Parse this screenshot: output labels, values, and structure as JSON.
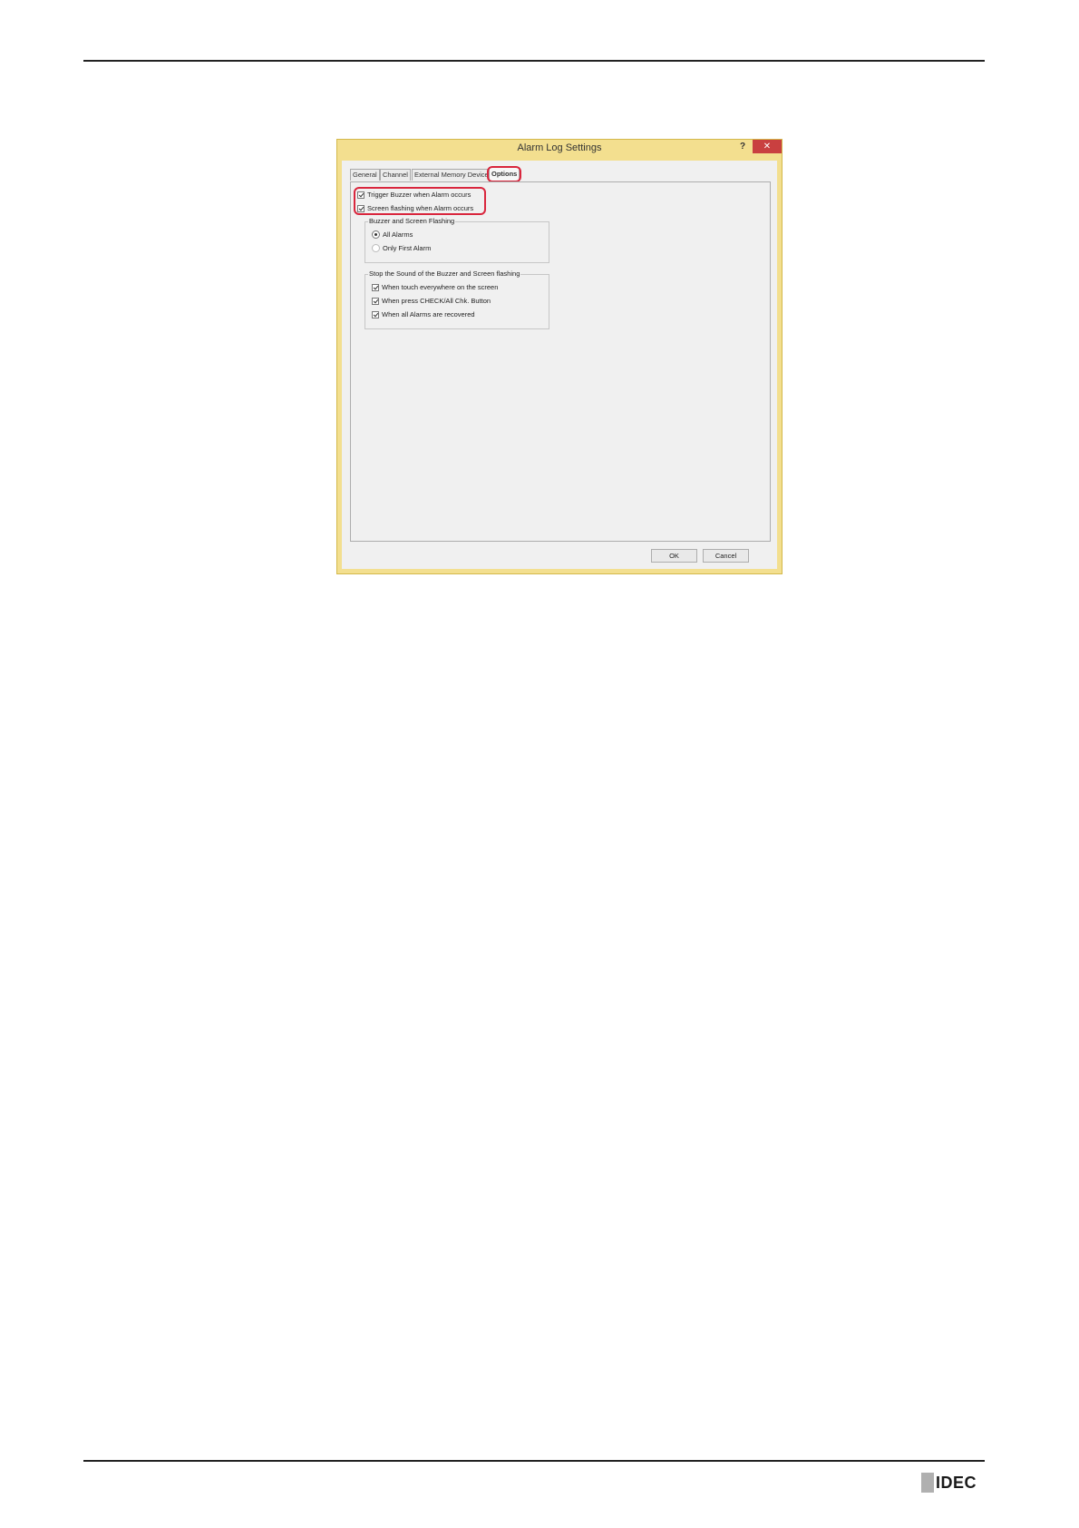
{
  "dialog": {
    "title": "Alarm Log Settings",
    "help_label": "?",
    "close_label": "✕",
    "tabs": [
      {
        "label": "General"
      },
      {
        "label": "Channel"
      },
      {
        "label": "External Memory Device"
      },
      {
        "label": "Options"
      }
    ],
    "options": {
      "trigger_buzzer": {
        "label": "Trigger Buzzer when Alarm occurs",
        "checked": true
      },
      "screen_flashing": {
        "label": "Screen flashing when Alarm occurs",
        "checked": true
      },
      "buzzer_group": {
        "label": "Buzzer and Screen Flashing",
        "all_alarms": {
          "label": "All Alarms",
          "selected": true
        },
        "only_first_alarm": {
          "label": "Only First Alarm",
          "selected": false
        }
      },
      "stop_group": {
        "label": "Stop the Sound of the Buzzer and Screen flashing",
        "touch_anywhere": {
          "label": "When touch everywhere on the screen",
          "checked": true
        },
        "press_check": {
          "label": "When press CHECK/All Chk. Button",
          "checked": true
        },
        "all_recovered": {
          "label": "When all Alarms are recovered",
          "checked": true
        }
      }
    },
    "ok_label": "OK",
    "cancel_label": "Cancel"
  },
  "logo": {
    "text": "IDEC"
  },
  "colors": {
    "highlight": "#d9263d",
    "frame": "#f3df8f",
    "close": "#c94040"
  }
}
